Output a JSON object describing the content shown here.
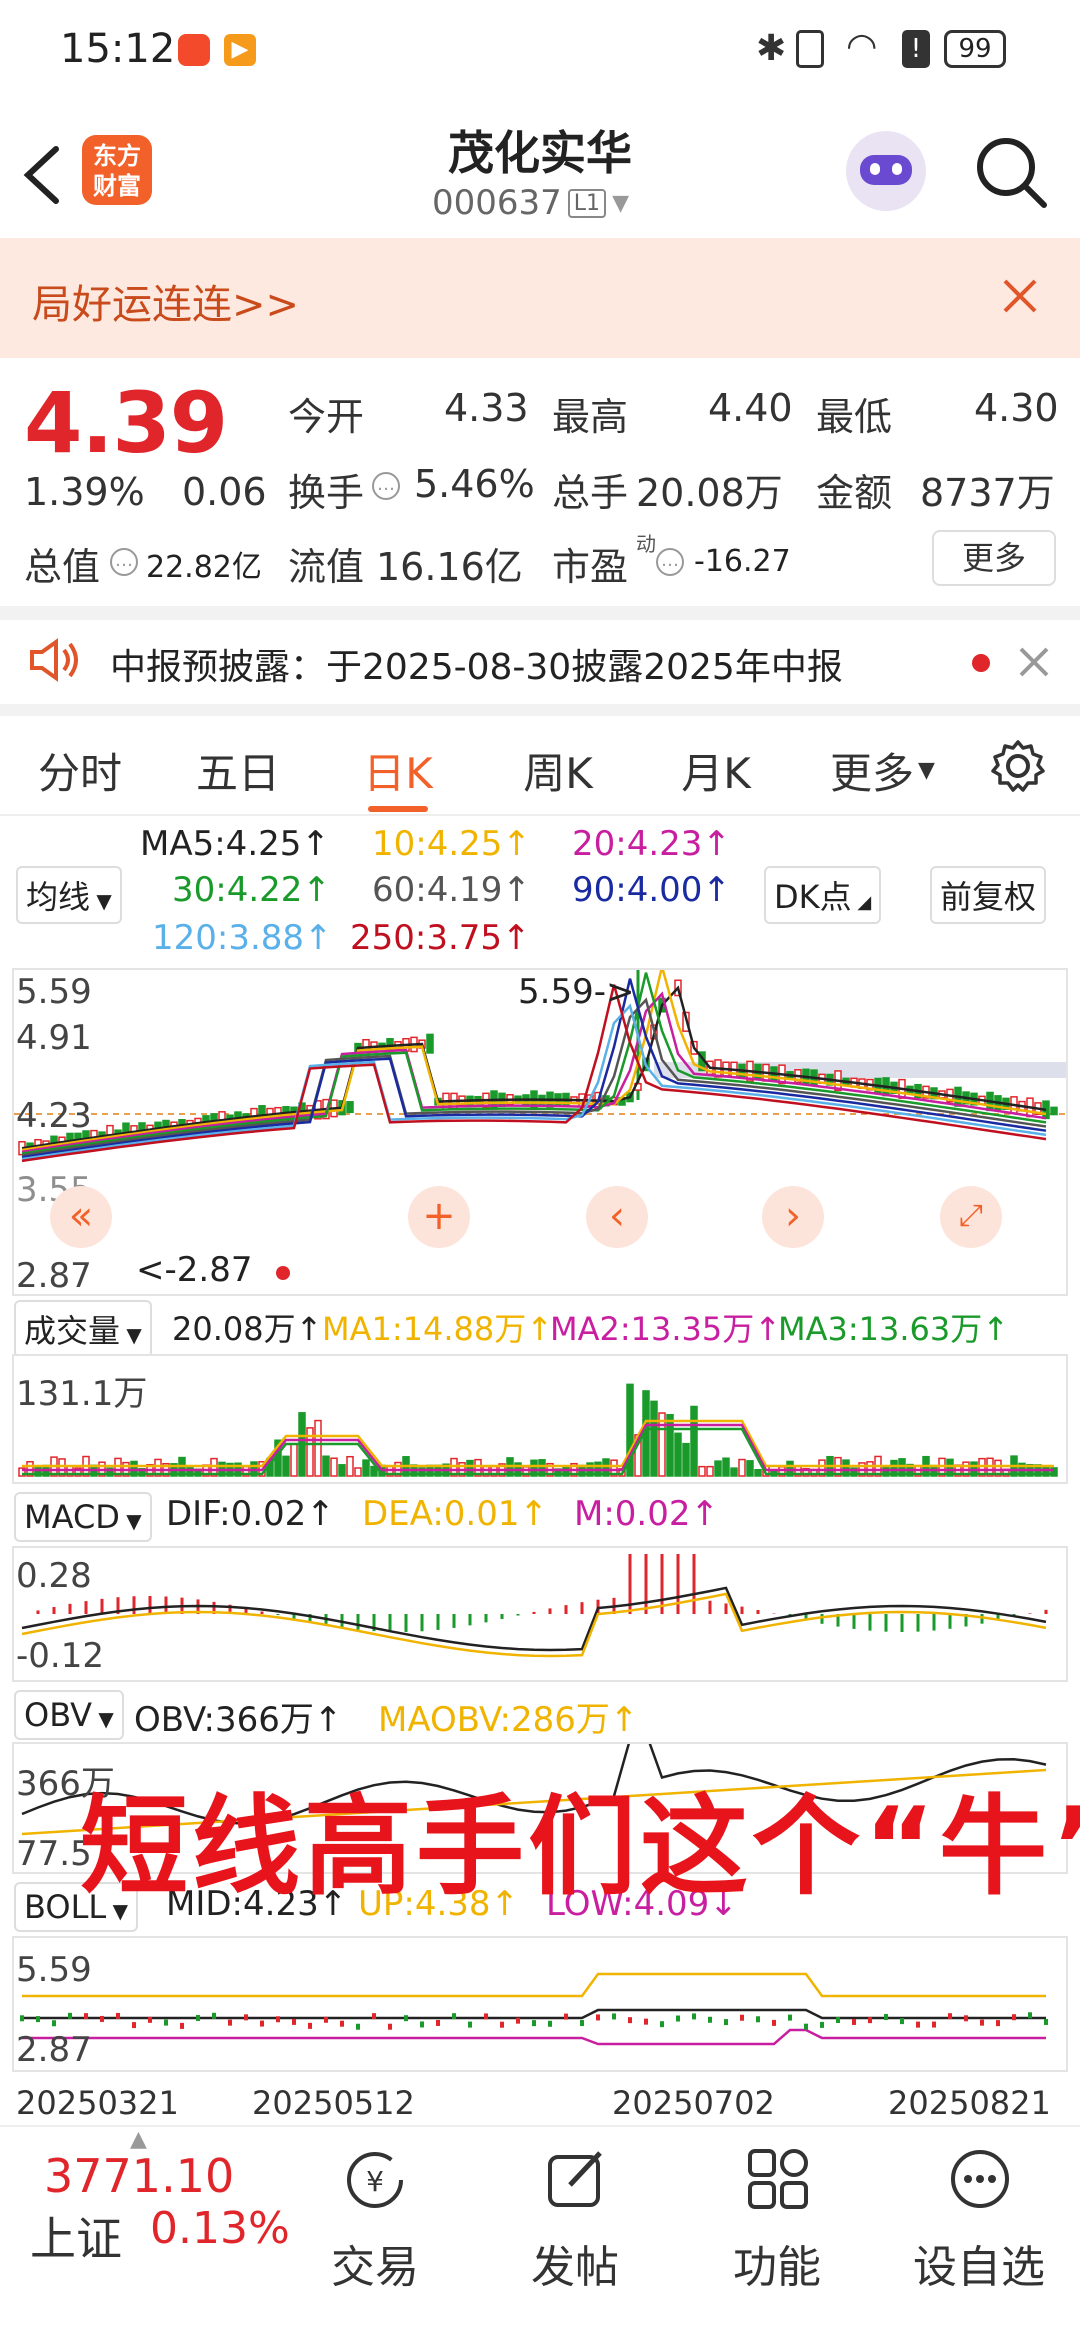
{
  "status_bar": {
    "time": "15:12",
    "battery": "99"
  },
  "header": {
    "logo": "东方\n财富",
    "title": "茂化实华",
    "code": "000637",
    "level_badge": "L1"
  },
  "banner": {
    "text": "局好运连连>>"
  },
  "quote": {
    "price": "4.39",
    "change_pct": "1.39%",
    "change": "0.06",
    "open_label": "今开",
    "open": "4.33",
    "high_label": "最高",
    "high": "4.40",
    "low_label": "最低",
    "low": "4.30",
    "turnover_label": "换手",
    "turnover": "5.46%",
    "volume_label": "总手",
    "volume": "20.08万",
    "amount_label": "金额",
    "amount": "8737万",
    "mktcap_label": "总值",
    "mktcap": "22.82亿",
    "float_label": "流值",
    "float": "16.16亿",
    "pe_label": "市盈",
    "pe_sup": "动",
    "pe": "-16.27",
    "more_label": "更多"
  },
  "notice": {
    "text": "中报预披露：于2025-08-30披露2025年中报"
  },
  "tabs": [
    "分时",
    "五日",
    "日K",
    "周K",
    "月K",
    "更多"
  ],
  "active_tab": "日K",
  "ma": {
    "selector": "均线",
    "ma5": "MA5:4.25↑",
    "ma10": "10:4.25↑",
    "ma20": "20:4.23↑",
    "ma30": "30:4.22↑",
    "ma60": "60:4.19↑",
    "ma90": "90:4.00↑",
    "ma120": "120:3.88↑",
    "ma250": "250:3.75↑",
    "dk_button": "DK点",
    "adjust_button": "前复权",
    "colors": {
      "ma5": "#222222",
      "ma10": "#f0b400",
      "ma20": "#c81ea0",
      "ma30": "#1a9a2a",
      "ma60": "#555555",
      "ma90": "#1a2aa0",
      "ma120": "#5ab0e8",
      "ma250": "#c01020"
    }
  },
  "kline": {
    "y_labels": [
      "5.59",
      "4.91",
      "4.23",
      "3.55",
      "2.87"
    ],
    "max_marker": "5.59->",
    "min_marker": "<-2.87"
  },
  "volume": {
    "selector": "成交量",
    "value": "20.08万↑",
    "ma1": "MA1:14.88万↑",
    "ma2": "MA2:13.35万↑",
    "ma3": "MA3:13.63万↑",
    "y_label": "131.1万"
  },
  "macd": {
    "selector": "MACD",
    "dif": "DIF:0.02↑",
    "dea": "DEA:0.01↑",
    "m": "M:0.02↑",
    "y_labels": [
      "0.28",
      "-0.12"
    ]
  },
  "obv": {
    "selector": "OBV",
    "obv": "OBV:366万↑",
    "maobv": "MAOBV:286万↑",
    "y_labels": [
      "366万",
      "77.5"
    ]
  },
  "boll": {
    "selector": "BOLL",
    "mid": "MID:4.23↑",
    "up": "UP:4.38↑",
    "low": "LOW:4.09↓",
    "y_labels": [
      "5.59",
      "2.87"
    ]
  },
  "x_dates": [
    "20250321",
    "20250512",
    "20250702",
    "20250821"
  ],
  "overlay_text": "短线高手们这个“牛”",
  "bottom_nav": {
    "index_value": "3771.10",
    "index_name": "上证",
    "index_change": "0.13%",
    "items": [
      "交易",
      "发帖",
      "功能",
      "设自选"
    ]
  }
}
